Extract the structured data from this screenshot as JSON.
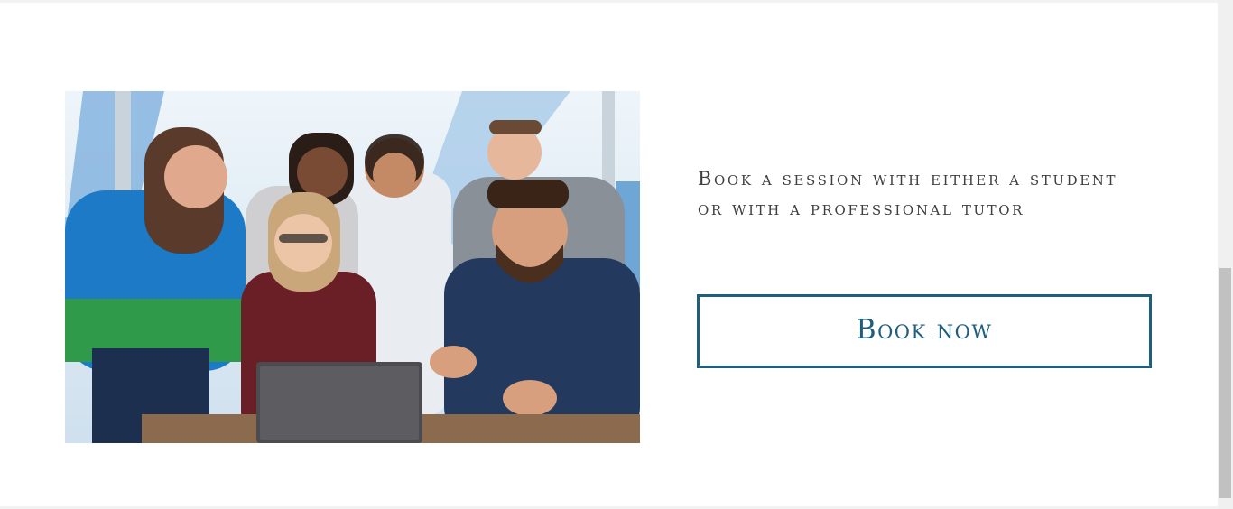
{
  "hero": {
    "image_icon": "group-photo-image",
    "tagline": "Book a session with either a student or with a professional tutor",
    "button_label": "Book now"
  },
  "colors": {
    "accent": "#1f5f7e",
    "text": "#3f3f3f",
    "background": "#ffffff"
  }
}
